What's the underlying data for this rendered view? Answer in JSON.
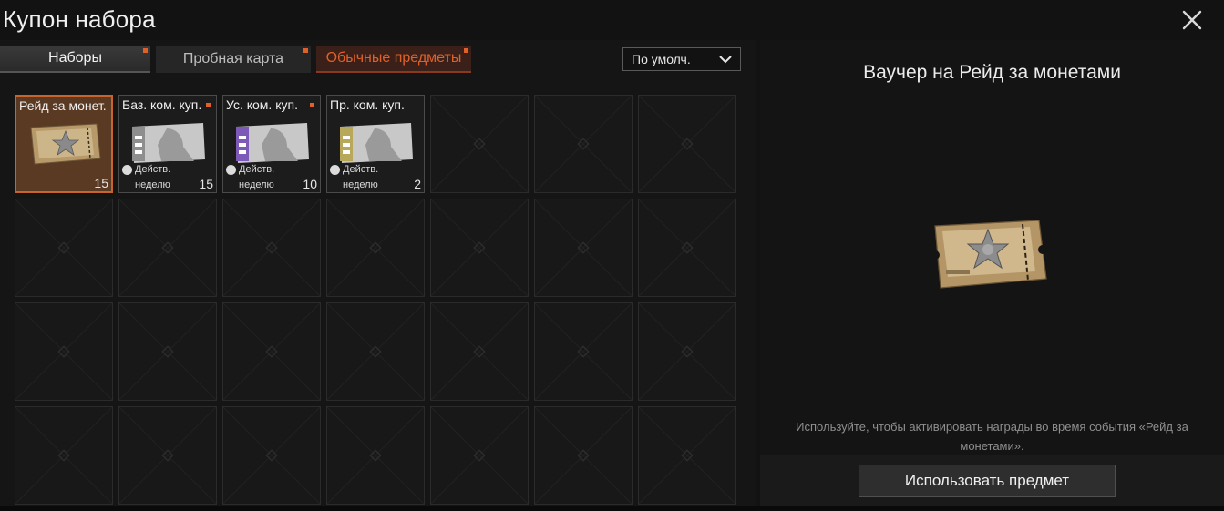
{
  "window": {
    "title": "Купон набора",
    "close_icon": "close-icon"
  },
  "tabs": [
    {
      "label": "Наборы",
      "has_notification": true,
      "active": true
    },
    {
      "label": "Пробная карта",
      "has_notification": true,
      "active": false
    },
    {
      "label": "Обычные предметы",
      "has_notification": true,
      "active": false
    }
  ],
  "sort": {
    "selected": "По умолч."
  },
  "grid": {
    "columns": 7,
    "rows": 4,
    "items": [
      {
        "name": "Рейд за монет.",
        "count": "15",
        "thumbnail": "coin-raid-voucher-ticket",
        "selected": true,
        "has_notification": false
      },
      {
        "name": "Баз. ком. куп.",
        "count": "15",
        "thumbnail": "basic-commander-coupon-gray",
        "validity_line1": "Действ.",
        "validity_line2": "неделю",
        "has_notification": true
      },
      {
        "name": "Ус. ком. куп.",
        "count": "10",
        "thumbnail": "advanced-commander-coupon-purple",
        "validity_line1": "Действ.",
        "validity_line2": "неделю",
        "has_notification": true
      },
      {
        "name": "Пр. ком. куп.",
        "count": "2",
        "thumbnail": "premium-commander-coupon-gold",
        "validity_line1": "Действ.",
        "validity_line2": "неделю",
        "has_notification": false
      }
    ]
  },
  "detail": {
    "title": "Ваучер на Рейд за монетами",
    "image": "coin-raid-voucher-ticket",
    "description": "Используйте, чтобы активировать награды во время события «Рейд за монетами».",
    "use_button": "Использовать предмет"
  },
  "colors": {
    "accent": "#e0602a",
    "selected_border": "#c8652e",
    "background": "#121212"
  }
}
